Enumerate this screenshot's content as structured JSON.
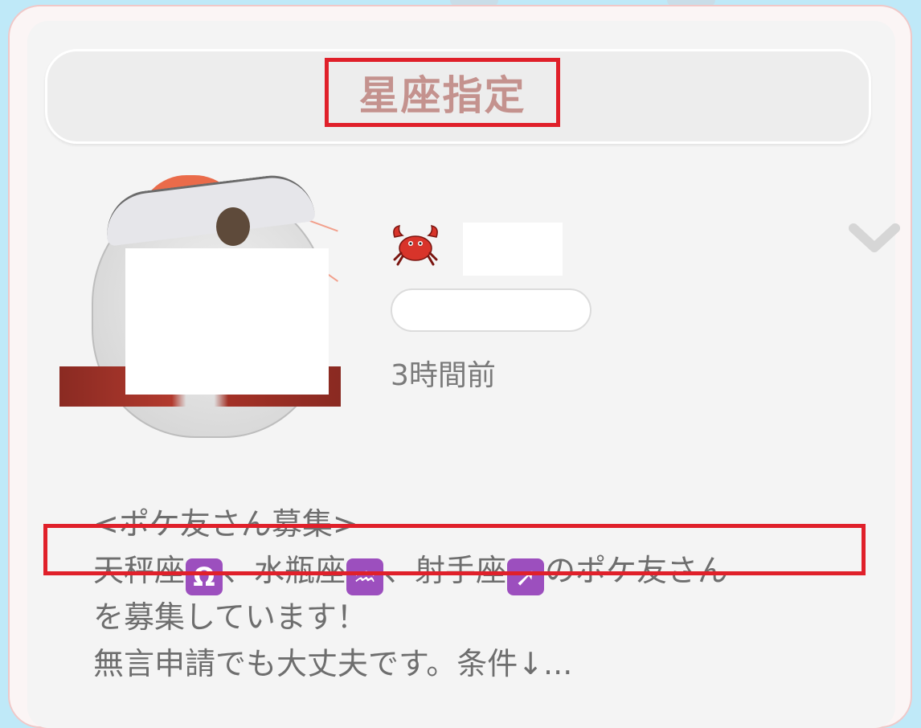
{
  "header": {
    "title": "星座指定"
  },
  "post": {
    "zodiac_icon": "crab-icon",
    "time_ago": "3時間前",
    "line1": "<ポケ友さん募集>",
    "line2": {
      "a": "天秤座",
      "a_sym": "Ω",
      "b": "、水瓶座",
      "b_sym": "♒",
      "c": "、射手座",
      "c_sym": "➚",
      "d": "のポケ友さん"
    },
    "line3": "を募集しています！",
    "line4": "無言申請でも大丈夫です。条件↓..."
  },
  "colors": {
    "accent_red": "#e0202a",
    "title_pink": "#c4928e",
    "zodiac_purple": "#9c4fbe",
    "background_blue": "#bfe9f8"
  }
}
